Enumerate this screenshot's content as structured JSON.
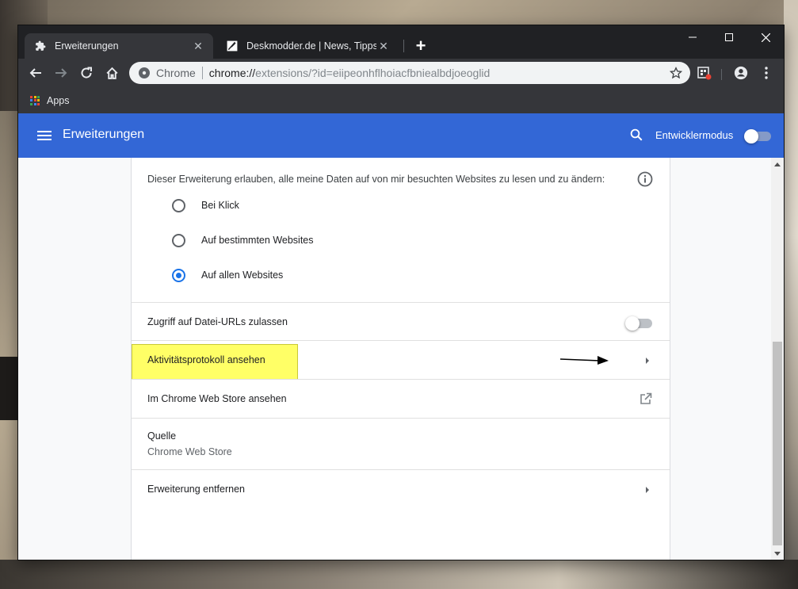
{
  "tabs": [
    {
      "label": "Erweiterungen",
      "icon": "puzzle-icon",
      "active": true
    },
    {
      "label": "Deskmodder.de | News, Tipps und",
      "icon": "feather-icon",
      "active": false
    }
  ],
  "omnibox": {
    "site_label": "Chrome",
    "url_scheme": "chrome://",
    "url_rest": "extensions/?id=eiipeonhflhoiacfbniealbdjoeoglid"
  },
  "bookmarks": {
    "apps_label": "Apps"
  },
  "header": {
    "title": "Erweiterungen",
    "devmode_label": "Entwicklermodus",
    "devmode_on": false
  },
  "site_access": {
    "prompt": "Dieser Erweiterung erlauben, alle meine Daten auf von mir besuchten Websites zu lesen und zu ändern:",
    "options": [
      {
        "label": "Bei Klick",
        "selected": false
      },
      {
        "label": "Auf bestimmten Websites",
        "selected": false
      },
      {
        "label": "Auf allen Websites",
        "selected": true
      }
    ]
  },
  "rows": {
    "file_urls": {
      "label": "Zugriff auf Datei-URLs zulassen",
      "enabled": false
    },
    "activity_log": {
      "label": "Aktivitätsprotokoll ansehen"
    },
    "web_store": {
      "label": "Im Chrome Web Store ansehen"
    },
    "source": {
      "label": "Quelle",
      "value": "Chrome Web Store"
    },
    "remove": {
      "label": "Erweiterung entfernen"
    }
  },
  "colors": {
    "header_blue": "#3367d6",
    "radio_selected": "#1a73e8",
    "highlight_yellow": "#ffff66",
    "frame_dark": "#202124"
  }
}
